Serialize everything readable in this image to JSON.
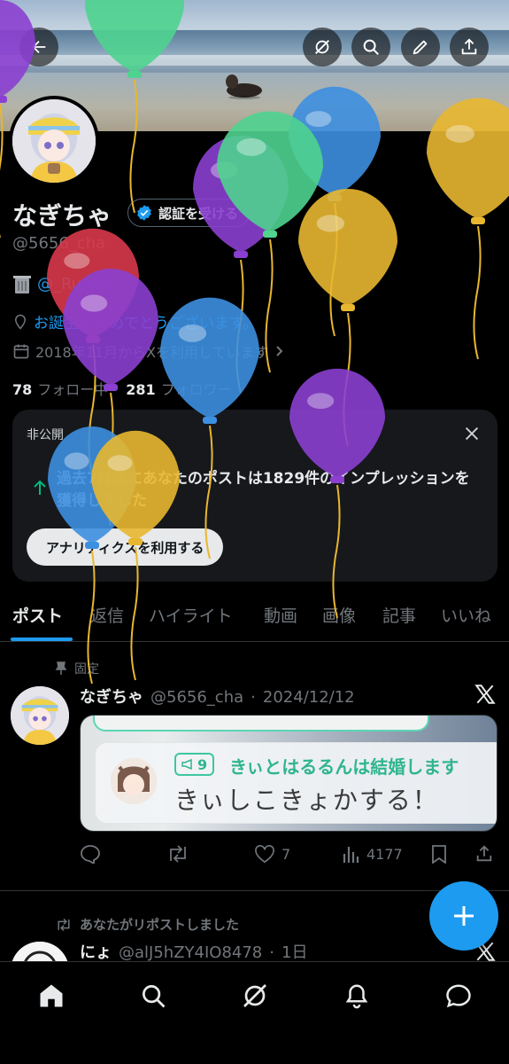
{
  "header": {
    "back_icon": "arrow-left-icon",
    "actions": [
      "grok-icon",
      "search-icon",
      "edit-icon",
      "share-icon"
    ]
  },
  "profile": {
    "name": "なぎちゃ",
    "verify_label": "認証を受ける",
    "handle": "@5656_cha",
    "bio_mention": "@_RunaX",
    "location": "お誕生日おめでとうございます。",
    "joined": "2018年11月からXを利用しています",
    "following_count": "78",
    "following_label": "フォロー中",
    "followers_count": "281",
    "followers_label": "フォロワー"
  },
  "analytics_card": {
    "label": "非公開",
    "message": "過去7日間にあなたのポストは1829件のインプレッションを獲得しました",
    "cta": "アナリティクスを利用する"
  },
  "tabs": [
    "ポスト",
    "返信",
    "ハイライト",
    "動画",
    "画像",
    "記事",
    "いいね"
  ],
  "active_tab": "ポスト",
  "pinned_post": {
    "pinned_label": "固定",
    "name": "なぎちゃ",
    "handle": "@5656_cha",
    "date": "2024/12/12",
    "media": {
      "badge_count": "9",
      "quote": "きぃとはるるんは結婚します",
      "main_text": "きぃしこきょかする！"
    },
    "replies": "",
    "reposts": "",
    "likes": "7",
    "views": "4177"
  },
  "second_post": {
    "repost_note": "あなたがリポストしました",
    "name": "にょ",
    "handle": "@alJ5hZY4IO8478",
    "date": "1日"
  },
  "bottom_nav": [
    "home-icon",
    "search-icon",
    "grok-icon",
    "notifications-icon",
    "messages-icon"
  ],
  "colors": {
    "accent": "#1d9bf0",
    "background": "#000000",
    "card": "#16181c",
    "muted": "#71767b",
    "balloon_yellow": "#e8b730",
    "balloon_purple": "#8b3fd0",
    "balloon_green": "#4fd38f",
    "balloon_blue": "#3d8fe0",
    "balloon_red": "#d9394a"
  }
}
